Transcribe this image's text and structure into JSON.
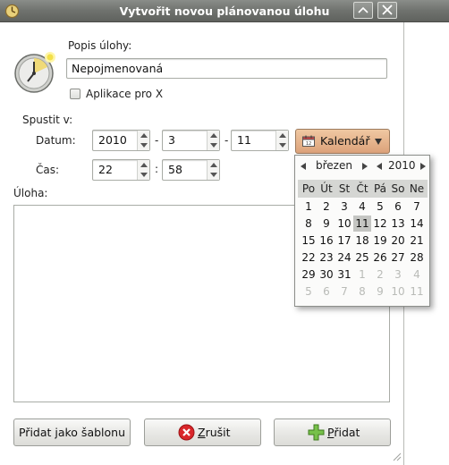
{
  "window": {
    "title": "Vytvořit novou plánovanou úlohu",
    "icon": "gnome-schedule-app-icon",
    "controls": [
      "minimize-icon",
      "close-icon"
    ]
  },
  "form": {
    "description_label": "Popis úlohy:",
    "description_value": "Nepojmenovaná",
    "x_app_checkbox_label": "Aplikace pro X",
    "x_app_checked": false,
    "run_at_label": "Spustit v:",
    "date_label": "Datum:",
    "year": "2010",
    "month": "3",
    "day": "11",
    "date_sep1": "-",
    "date_sep2": "-",
    "time_label": "Čas:",
    "hour": "22",
    "minute": "58",
    "time_sep": ":",
    "calendar_button": "Kalendář",
    "task_label": "Úloha:",
    "task_text": ""
  },
  "calendar": {
    "month": "březen",
    "year": "2010",
    "weekdays": [
      "Po",
      "Út",
      "St",
      "Čt",
      "Pá",
      "So",
      "Ne"
    ],
    "selected_day": "11",
    "weeks": [
      [
        {
          "t": "1"
        },
        {
          "t": "2"
        },
        {
          "t": "3"
        },
        {
          "t": "4"
        },
        {
          "t": "5"
        },
        {
          "t": "6"
        },
        {
          "t": "7"
        }
      ],
      [
        {
          "t": "8"
        },
        {
          "t": "9"
        },
        {
          "t": "10"
        },
        {
          "t": "11",
          "sel": true
        },
        {
          "t": "12"
        },
        {
          "t": "13"
        },
        {
          "t": "14"
        }
      ],
      [
        {
          "t": "15"
        },
        {
          "t": "16"
        },
        {
          "t": "17"
        },
        {
          "t": "18"
        },
        {
          "t": "19"
        },
        {
          "t": "20"
        },
        {
          "t": "21"
        }
      ],
      [
        {
          "t": "22"
        },
        {
          "t": "23"
        },
        {
          "t": "24"
        },
        {
          "t": "25"
        },
        {
          "t": "26"
        },
        {
          "t": "27"
        },
        {
          "t": "28"
        }
      ],
      [
        {
          "t": "29"
        },
        {
          "t": "30"
        },
        {
          "t": "31"
        },
        {
          "t": "1",
          "dim": true
        },
        {
          "t": "2",
          "dim": true
        },
        {
          "t": "3",
          "dim": true
        },
        {
          "t": "4",
          "dim": true
        }
      ],
      [
        {
          "t": "5",
          "dim": true
        },
        {
          "t": "6",
          "dim": true
        },
        {
          "t": "7",
          "dim": true
        },
        {
          "t": "8",
          "dim": true
        },
        {
          "t": "9",
          "dim": true
        },
        {
          "t": "10",
          "dim": true
        },
        {
          "t": "11",
          "dim": true
        }
      ]
    ]
  },
  "buttons": {
    "template": "Přidat jako šablonu",
    "cancel_prefix": "Z",
    "cancel_rest": "rušit",
    "add_prefix": "P",
    "add_rest": "řidat",
    "cancel_icon": "cancel-icon",
    "add_icon": "add-icon"
  },
  "colors": {
    "titlebar": "#6f726e",
    "calendar_button": "#dca27a",
    "cancel_icon": "#d9262a",
    "add_icon": "#77c14a"
  }
}
